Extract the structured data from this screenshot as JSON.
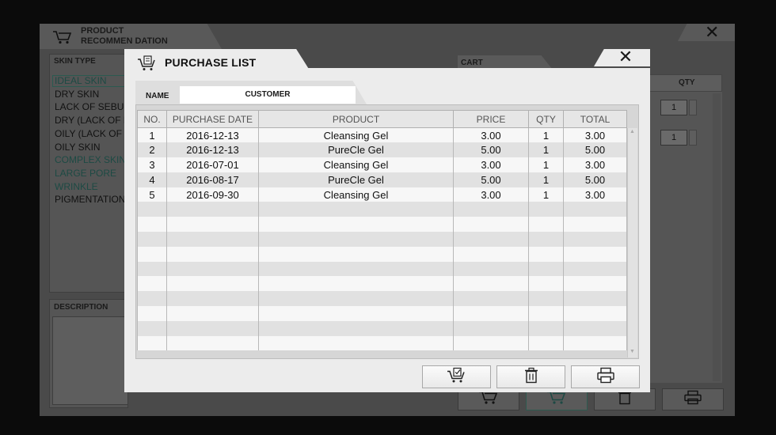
{
  "background_app": {
    "title_line1": "PRODUCT",
    "title_line2": "RECOMMEN DATION",
    "skin_type_header": "SKIN TYPE",
    "skin_types": [
      {
        "label": "IDEAL SKIN",
        "teal": true
      },
      {
        "label": "DRY SKIN",
        "teal": false
      },
      {
        "label": "LACK OF SEBUM",
        "teal": false
      },
      {
        "label": "DRY (LACK OF M",
        "teal": false
      },
      {
        "label": "OILY (LACK OF M",
        "teal": false
      },
      {
        "label": "OILY SKIN",
        "teal": false
      },
      {
        "label": "COMPLEX SKIN",
        "teal": true
      },
      {
        "label": "LARGE PORE",
        "teal": true
      },
      {
        "label": "WRINKLE",
        "teal": true
      },
      {
        "label": "PIGMENTATION",
        "teal": false
      }
    ],
    "description_header": "DESCRIPTION",
    "cart_label": "CART",
    "qty_header": "QTY",
    "qty_values": [
      "1",
      "1"
    ]
  },
  "dialog": {
    "title": "PURCHASE LIST",
    "close_label": "✕",
    "name_label": "NAME",
    "name_value": "CUSTOMER",
    "columns": [
      "NO.",
      "PURCHASE DATE",
      "PRODUCT",
      "PRICE",
      "QTY",
      "TOTAL"
    ],
    "rows": [
      {
        "no": "1",
        "date": "2016-12-13",
        "product": "Cleansing Gel",
        "price": "3.00",
        "qty": "1",
        "total": "3.00"
      },
      {
        "no": "2",
        "date": "2016-12-13",
        "product": "PureCle Gel",
        "price": "5.00",
        "qty": "1",
        "total": "5.00"
      },
      {
        "no": "3",
        "date": "2016-07-01",
        "product": "Cleansing Gel",
        "price": "3.00",
        "qty": "1",
        "total": "3.00"
      },
      {
        "no": "4",
        "date": "2016-08-17",
        "product": "PureCle Gel",
        "price": "5.00",
        "qty": "1",
        "total": "5.00"
      },
      {
        "no": "5",
        "date": "2016-09-30",
        "product": "Cleansing Gel",
        "price": "3.00",
        "qty": "1",
        "total": "3.00"
      }
    ],
    "empty_rows": 10,
    "buttons": [
      {
        "icon": "cart-checkout-icon"
      },
      {
        "icon": "trash-icon"
      },
      {
        "icon": "printer-icon"
      }
    ]
  },
  "colors": {
    "accent_teal": "#1d4a44",
    "dialog_bg": "#ececec",
    "backdrop": "#0b0b0b"
  }
}
